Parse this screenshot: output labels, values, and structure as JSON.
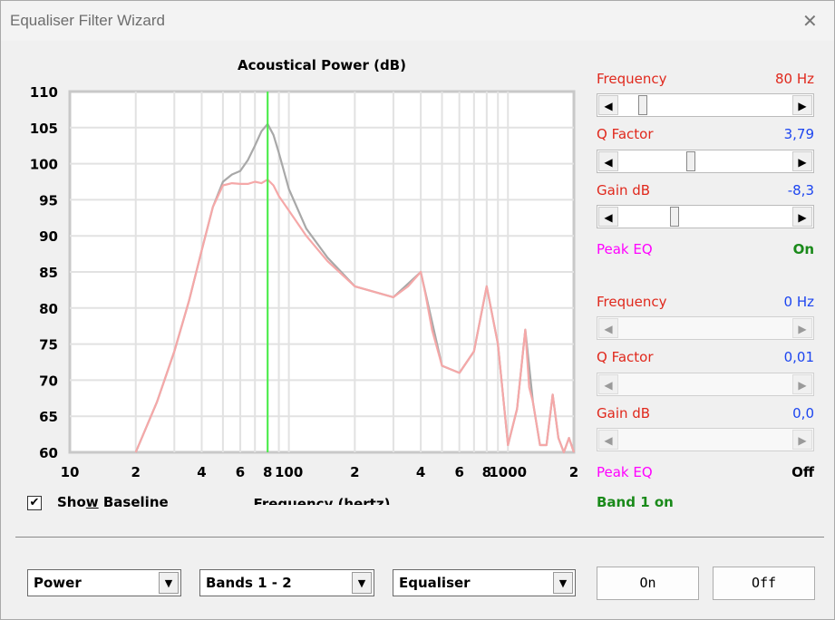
{
  "window": {
    "title": "Equaliser Filter Wizard",
    "close_glyph": "✕"
  },
  "chart_data": {
    "type": "line",
    "title": "Acoustical Power (dB)",
    "xlabel": "Frequency (hertz)",
    "ylabel": "",
    "x_scale": "log",
    "xlim": [
      10,
      2000
    ],
    "ylim": [
      60,
      110
    ],
    "grid": true,
    "yticks": [
      "110",
      "105",
      "100",
      "95",
      "90",
      "85",
      "80",
      "75",
      "70",
      "65",
      "60"
    ],
    "ytick_values": [
      110,
      105,
      100,
      95,
      90,
      85,
      80,
      75,
      70,
      65,
      60
    ],
    "xticks": [
      "10",
      "2",
      "4",
      "6",
      "8",
      "100",
      "2",
      "4",
      "6",
      "8",
      "1000",
      "2"
    ],
    "xtick_values": [
      10,
      20,
      40,
      60,
      80,
      100,
      200,
      400,
      600,
      800,
      1000,
      2000
    ],
    "marker_frequency": 80,
    "series": [
      {
        "color": "#a8a8a8",
        "x": [
          20,
          25,
          30,
          35,
          40,
          45,
          50,
          55,
          60,
          65,
          70,
          75,
          80,
          85,
          90,
          100,
          120,
          150,
          200,
          300,
          400,
          500,
          600,
          700,
          800,
          900,
          1000,
          1100,
          1200,
          1300,
          1400,
          1500,
          1600,
          1700,
          1800,
          1900,
          2000
        ],
        "y": [
          60,
          67,
          74,
          81,
          88,
          94,
          97.5,
          98.5,
          99,
          100.5,
          102.5,
          104.5,
          105.5,
          104,
          101.5,
          96.5,
          91,
          87,
          83,
          81.5,
          85,
          72,
          71,
          74,
          83,
          75,
          61,
          66,
          77,
          67,
          61,
          61,
          68,
          62,
          60,
          62,
          60
        ]
      },
      {
        "color": "#f5a8a8",
        "x": [
          20,
          25,
          30,
          35,
          40,
          45,
          50,
          55,
          60,
          65,
          70,
          75,
          80,
          85,
          90,
          100,
          120,
          150,
          200,
          300,
          350,
          400,
          420,
          450,
          500,
          600,
          700,
          800,
          900,
          1000,
          1100,
          1200,
          1250,
          1300,
          1400,
          1500,
          1600,
          1700,
          1800,
          1900,
          2000
        ],
        "y": [
          60,
          67,
          74,
          81,
          88,
          94,
          97,
          97.3,
          97.2,
          97.2,
          97.5,
          97.3,
          97.8,
          97,
          95.5,
          93.5,
          90,
          86.5,
          83,
          81.5,
          83,
          85,
          82,
          77,
          72,
          71,
          74,
          83,
          75,
          61,
          66,
          77,
          69,
          67,
          61,
          61,
          68,
          62,
          60,
          62,
          60
        ]
      }
    ]
  },
  "show_baseline": {
    "label_pre": "Sho",
    "label_key": "w",
    "label_post": " Baseline",
    "checked": true,
    "check_glyph": "✔"
  },
  "band1": {
    "frequency_label": "Frequency",
    "frequency_value": "80 Hz",
    "frequency_pos": 0.12,
    "q_label": "Q Factor",
    "q_value": "3,79",
    "q_pos": 0.47,
    "gain_label": "Gain  dB",
    "gain_value": "-8,3",
    "gain_pos": 0.37,
    "type_label": "Peak EQ",
    "state": "On"
  },
  "band2": {
    "frequency_label": "Frequency",
    "frequency_value": "0 Hz",
    "q_label": "Q Factor",
    "q_value": "0,01",
    "gain_label": "Gain  dB",
    "gain_value": "0,0",
    "type_label": "Peak EQ",
    "state": "Off"
  },
  "band_status": "Band 1 on",
  "slider_arrows": {
    "left": "◀",
    "right": "▶"
  },
  "bottom": {
    "combo1": "Power",
    "combo2": "Bands 1 - 2",
    "combo3": "Equaliser",
    "combo_arrow": "▼",
    "on_button": "On",
    "off_button": "Off"
  },
  "colors": {
    "grid": "#e2e2e2",
    "plot_bg": "#ffffff",
    "marker": "#44ee44",
    "baseline": "#a8a8a8",
    "eq_curve": "#f5a8a8"
  }
}
